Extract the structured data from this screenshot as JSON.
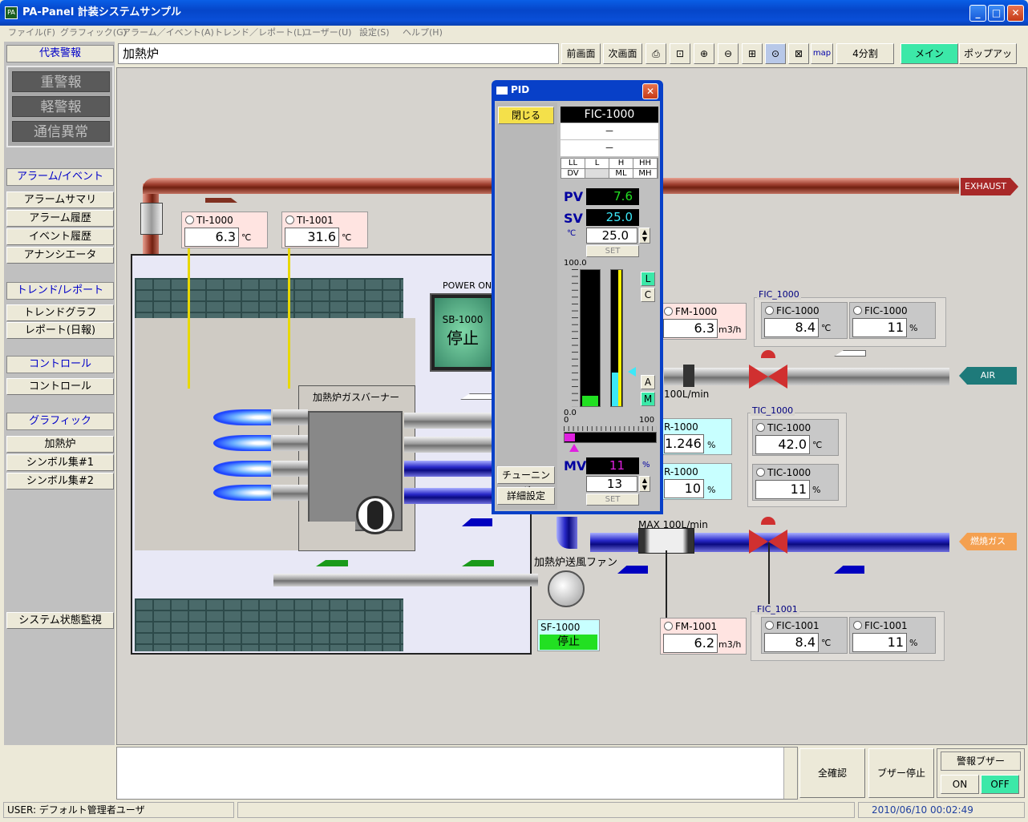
{
  "window": {
    "title": "PA-Panel 計装システムサンプル"
  },
  "menu": [
    "ファイル(F)",
    "グラフィック(G)",
    "アラーム／イベント(A)",
    "トレンド／レポート(L)",
    "ユーザー(U)",
    "設定(S)",
    "ヘルプ(H)"
  ],
  "sidebar": {
    "alarm_head": "代表警報",
    "alarms": [
      "重警報",
      "軽警報",
      "通信異常"
    ],
    "sections": [
      {
        "head": "アラーム/イベント",
        "items": [
          "アラームサマリ",
          "アラーム履歴",
          "イベント履歴",
          "アナンシエータ"
        ]
      },
      {
        "head": "トレンド/レポート",
        "items": [
          "トレンドグラフ",
          "レポート(日報)"
        ]
      },
      {
        "head": "コントロール",
        "items": [
          "コントロール"
        ]
      },
      {
        "head": "グラフィック",
        "items": [
          "加熱炉",
          "シンボル集#1",
          "シンボル集#2"
        ]
      }
    ],
    "system_btn": "システム状態監視"
  },
  "toolbar": {
    "screen_name": "加熱炉",
    "prev": "前画面",
    "next": "次画面",
    "map": "map",
    "split": "4分割",
    "main": "メイン",
    "popup": "ポップアップ"
  },
  "canvas": {
    "exhaust": "EXHAUST",
    "air": "AIR",
    "fuel": "燃焼ガス",
    "ti1000": {
      "tag": "TI-1000",
      "value": "6.3",
      "unit": "℃"
    },
    "ti1001": {
      "tag": "TI-1001",
      "value": "31.6",
      "unit": "℃"
    },
    "power_on": "POWER ON",
    "sb1000": {
      "tag": "SB-1000",
      "state": "停止"
    },
    "burner": "加熱炉ガスバーナー",
    "fm1000": {
      "tag": "FM-1000",
      "value": "6.3",
      "unit": "m3/h"
    },
    "fic1000_grp": "FIC_1000",
    "fic1000a": {
      "tag": "FIC-1000",
      "value": "8.4",
      "unit": "℃"
    },
    "fic1000b": {
      "tag": "FIC-1000",
      "value": "11",
      "unit": "%"
    },
    "air_max": "100L/min",
    "tic_grp": "TIC_1000",
    "tic1000a": {
      "tag": "TIC-1000",
      "value": "42.0",
      "unit": "℃"
    },
    "tic1000b": {
      "tag": "TIC-1000",
      "value": "11",
      "unit": "%"
    },
    "r1000a": {
      "tag": "R-1000",
      "value": "1.246",
      "unit": "%"
    },
    "r1000b": {
      "tag": "R-1000",
      "value": "10",
      "unit": "%"
    },
    "fuel_max": "MAX 100L/min",
    "fan_label": "加熱炉送風ファン",
    "sf1000": {
      "tag": "SF-1000",
      "state": "停止"
    },
    "fm1001": {
      "tag": "FM-1001",
      "value": "6.2",
      "unit": "m3/h"
    },
    "fic1001_grp": "FIC_1001",
    "fic1001a": {
      "tag": "FIC-1001",
      "value": "8.4",
      "unit": "℃"
    },
    "fic1001b": {
      "tag": "FIC-1001",
      "value": "11",
      "unit": "%"
    }
  },
  "pid": {
    "title": "PID",
    "close": "閉じる",
    "tag": "FIC-1000",
    "line1": "－",
    "line2": "－",
    "alarm_top": [
      "LL",
      "L",
      "H",
      "HH"
    ],
    "alarm_bot": [
      "DV",
      "",
      "ML",
      "MH"
    ],
    "pv_label": "PV",
    "pv": "7.6",
    "sv_label": "SV",
    "sv": "25.0",
    "sv_unit": "℃",
    "sv_input": "25.0",
    "set": "SET",
    "scale_top": "100.0",
    "scale_bot": "0.0",
    "mv_scale_min": "0",
    "mv_scale_max": "100",
    "btn_l": "L",
    "btn_c": "C",
    "btn_a": "A",
    "btn_m": "M",
    "tuning": "チューニング",
    "detail": "詳細設定",
    "mv_label": "MV",
    "mv": "11",
    "mv_unit": "%",
    "mv_input": "13",
    "set2": "SET",
    "pv_frac": 0.076,
    "sv_frac": 0.25,
    "mv_frac": 0.11
  },
  "bottom": {
    "confirm_all": "全確認",
    "buzzer_stop": "ブザー停止",
    "buzzer": "警報ブザー",
    "on": "ON",
    "off": "OFF"
  },
  "status": {
    "user": "USER: デフォルト管理者ユーザ",
    "datetime": "2010/06/10 00:02:49"
  }
}
